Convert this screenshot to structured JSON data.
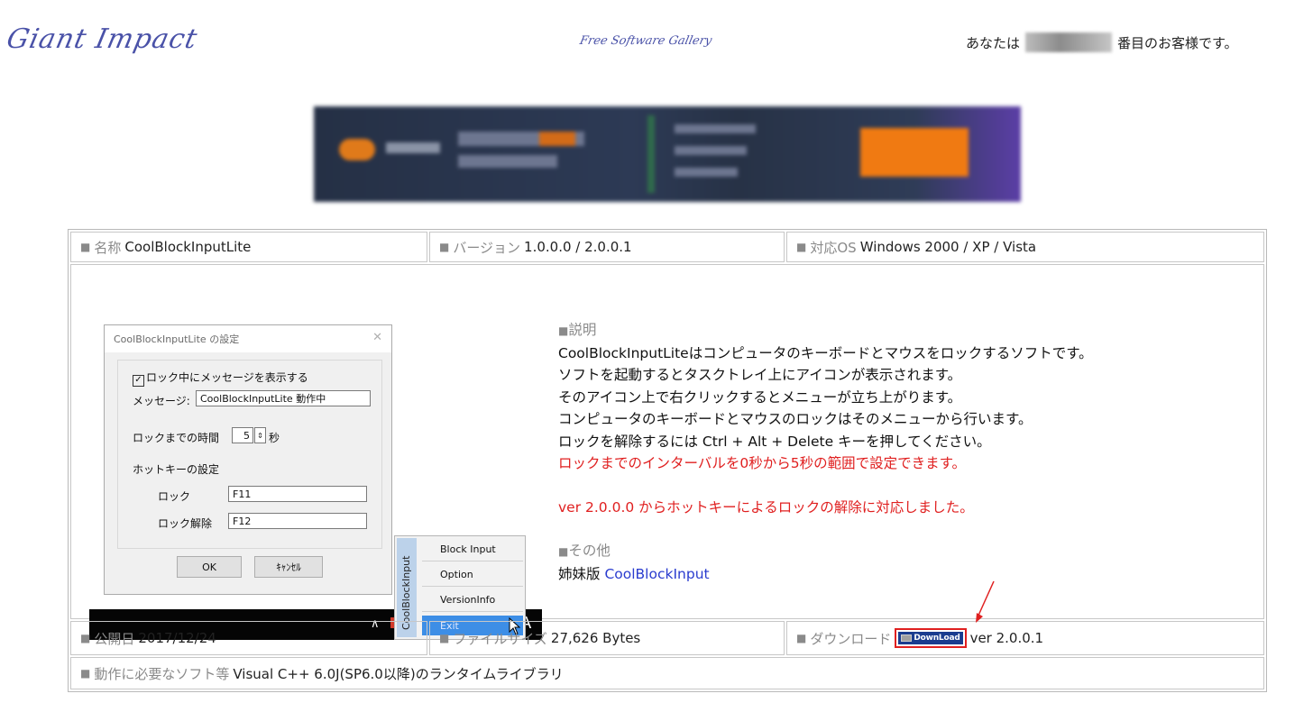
{
  "header": {
    "logo": "Giant Impact",
    "tagline": "Free Software Gallery",
    "visitor_prefix": "あなたは",
    "visitor_suffix": "番目のお客様です。"
  },
  "info": {
    "name_label": "名称",
    "name_value": "CoolBlockInputLite",
    "version_label": "バージョン",
    "version_value": "1.0.0.0 / 2.0.0.1",
    "os_label": "対応OS",
    "os_value": "Windows 2000 / XP / Vista",
    "release_label": "公開日",
    "release_value": "2017/12/24",
    "size_label": "ファイルサイズ",
    "size_value": "27,626 Bytes",
    "download_label": "ダウンロード",
    "download_button": "DownLoad",
    "download_version": "ver 2.0.0.1",
    "requirements_label": "動作に必要なソフト等",
    "requirements_value": "Visual C++ 6.0J(SP6.0以降)のランタイムライブラリ"
  },
  "dialog": {
    "title": "CoolBlockInputLite の設定",
    "show_message_checkbox": "ロック中にメッセージを表示する",
    "message_label": "メッセージ:",
    "message_value": "CoolBlockInputLite 動作中",
    "lock_time_label": "ロックまでの時間",
    "lock_time_value": "5",
    "lock_time_unit": "秒",
    "hotkey_heading": "ホットキーの設定",
    "lock_label": "ロック",
    "lock_value": "F11",
    "unlock_label": "ロック解除",
    "unlock_value": "F12",
    "ok": "OK",
    "cancel": "ｷｬﾝｾﾙ"
  },
  "context_menu": {
    "side_label": "CoolBlockInput",
    "items": [
      "Block Input",
      "Option",
      "VersionInfo",
      "Exit"
    ]
  },
  "description": {
    "heading": "説明",
    "lines": [
      "CoolBlockInputLiteはコンピュータのキーボードとマウスをロックするソフトです。",
      "ソフトを起動するとタスクトレイ上にアイコンが表示されます。",
      "そのアイコン上で右クリックするとメニューが立ち上がります。",
      "コンピュータのキーボードとマウスのロックはそのメニューから行います。",
      "ロックを解除するには Ctrl + Alt + Delete キーを押してください。"
    ],
    "red_line_1": "ロックまでのインターバルを0秒から5秒の範囲で設定できます。",
    "red_line_2": "ver 2.0.0.0 からホットキーによるロックの解除に対応しました。",
    "other_heading": "その他",
    "sister_prefix": "姉妹版",
    "sister_link": "CoolBlockInput"
  },
  "colors": {
    "logo": "#4a52a8",
    "red_text": "#e02020",
    "link": "#2a3ccf",
    "menu_highlight": "#3d8ee6"
  }
}
